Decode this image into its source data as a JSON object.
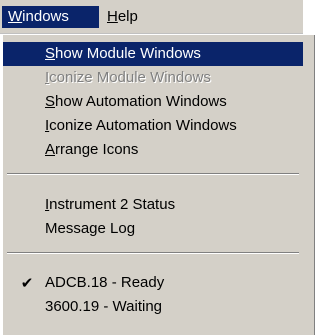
{
  "menubar": {
    "items": [
      {
        "label": "Windows",
        "mnemonic": "W",
        "rest": "indows",
        "active": true
      },
      {
        "label": "Help",
        "mnemonic": "H",
        "rest": "elp",
        "active": false
      }
    ]
  },
  "menu": {
    "items": [
      {
        "label": "Show Module Windows",
        "mnemonic": "S",
        "rest": "how Module Windows",
        "state": "highlighted"
      },
      {
        "label": "Iconize Module Windows",
        "mnemonic": "I",
        "rest": "conize Module Windows",
        "state": "disabled"
      },
      {
        "label": "Show Automation Windows",
        "mnemonic": "S",
        "rest": "how Automation Windows",
        "state": "normal"
      },
      {
        "label": "Iconize Automation Windows",
        "mnemonic": "I",
        "rest": "conize Automation Windows",
        "state": "normal"
      },
      {
        "label": "Arrange Icons",
        "mnemonic": "A",
        "rest": "rrange Icons",
        "state": "normal"
      },
      {
        "label": "Instrument 2 Status",
        "mnemonic": "I",
        "rest": "nstrument 2 Status",
        "state": "normal"
      },
      {
        "label": "Message Log",
        "mnemonic": "",
        "rest": "Message Log",
        "state": "normal"
      },
      {
        "label": "ADCB.18 - Ready",
        "checked": true,
        "check_glyph": "✔",
        "state": "normal"
      },
      {
        "label": "3600.19 - Waiting",
        "checked": false,
        "state": "normal"
      }
    ]
  },
  "colors": {
    "menu_bg": "#d4d0c8",
    "highlight_bg": "#0a246a",
    "highlight_text": "#ffffff",
    "disabled_text": "#808080"
  },
  "icons": {
    "check": "check-icon"
  }
}
